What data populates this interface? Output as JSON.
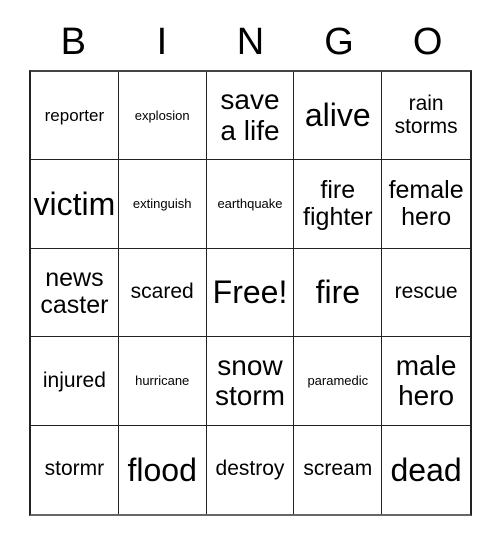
{
  "header": {
    "letters": [
      "B",
      "I",
      "N",
      "G",
      "O"
    ]
  },
  "grid": {
    "rows": 5,
    "columns": 5,
    "cells": [
      {
        "text": "reporter",
        "size": "s"
      },
      {
        "text": "explosion",
        "size": "xs"
      },
      {
        "text": "save\na life",
        "size": "xl"
      },
      {
        "text": "alive",
        "size": "xxl"
      },
      {
        "text": "rain\nstorms",
        "size": "m"
      },
      {
        "text": "victim",
        "size": "xxl"
      },
      {
        "text": "extinguish",
        "size": "xs"
      },
      {
        "text": "earthquake",
        "size": "xs"
      },
      {
        "text": "fire\nfighter",
        "size": "l"
      },
      {
        "text": "female\nhero",
        "size": "l"
      },
      {
        "text": "news\ncaster",
        "size": "l"
      },
      {
        "text": "scared",
        "size": "m"
      },
      {
        "text": "Free!",
        "size": "xxl"
      },
      {
        "text": "fire",
        "size": "xxl"
      },
      {
        "text": "rescue",
        "size": "m"
      },
      {
        "text": "injured",
        "size": "m"
      },
      {
        "text": "hurricane",
        "size": "xs"
      },
      {
        "text": "snow\nstorm",
        "size": "xl"
      },
      {
        "text": "paramedic",
        "size": "xs"
      },
      {
        "text": "male\nhero",
        "size": "xl"
      },
      {
        "text": "stormr",
        "size": "m"
      },
      {
        "text": "flood",
        "size": "xxl"
      },
      {
        "text": "destroy",
        "size": "m"
      },
      {
        "text": "scream",
        "size": "m"
      },
      {
        "text": "dead",
        "size": "xxl"
      }
    ]
  },
  "colors": {
    "background": "#ffffff",
    "text": "#000000",
    "border": "#222222"
  }
}
